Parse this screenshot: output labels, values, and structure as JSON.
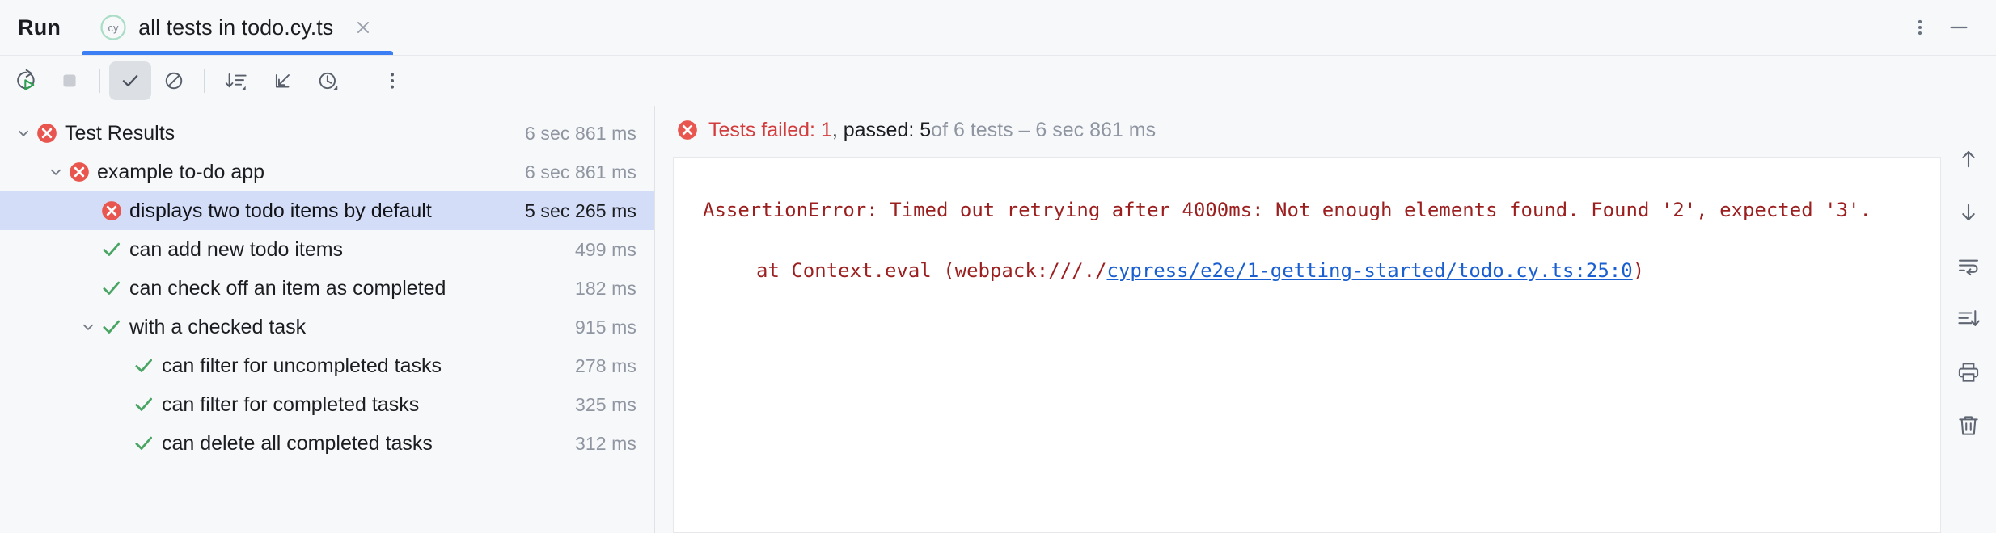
{
  "window": {
    "run_label": "Run",
    "more_options_icon": "more-vertical-icon",
    "minimize_icon": "minimize-icon"
  },
  "tab": {
    "icon": "cypress-icon",
    "title": "all tests in todo.cy.ts",
    "close_icon": "close-icon",
    "accent_color": "#3c7ef3"
  },
  "toolbar": {
    "items": [
      {
        "name": "rerun-tests-button",
        "icon": "rerun-icon",
        "active": false
      },
      {
        "name": "stop-button",
        "icon": "stop-square-icon",
        "active": false
      },
      {
        "name": "show-passed-button",
        "icon": "checkmark-icon",
        "active": true
      },
      {
        "name": "show-ignored-button",
        "icon": "circle-slash-icon",
        "active": false
      },
      {
        "name": "sort-button",
        "icon": "sort-descending-icon",
        "active": false
      },
      {
        "name": "expand-collapse-button",
        "icon": "collapse-arrow-icon",
        "active": false
      },
      {
        "name": "history-button",
        "icon": "clock-history-icon",
        "active": false
      },
      {
        "name": "more-options-button",
        "icon": "more-vertical-icon",
        "active": false
      }
    ]
  },
  "tree": {
    "rows": [
      {
        "label": "Test Results",
        "duration": "6 sec 861 ms",
        "status": "failed",
        "indent": 0,
        "expandable": true,
        "selected": false
      },
      {
        "label": "example to-do app",
        "duration": "6 sec 861 ms",
        "status": "failed",
        "indent": 1,
        "expandable": true,
        "selected": false
      },
      {
        "label": "displays two todo items by default",
        "duration": "5 sec 265 ms",
        "status": "failed",
        "indent": 2,
        "expandable": false,
        "selected": true
      },
      {
        "label": "can add new todo items",
        "duration": "499 ms",
        "status": "passed",
        "indent": 2,
        "expandable": false,
        "selected": false
      },
      {
        "label": "can check off an item as completed",
        "duration": "182 ms",
        "status": "passed",
        "indent": 2,
        "expandable": false,
        "selected": false
      },
      {
        "label": "with a checked task",
        "duration": "915 ms",
        "status": "passed",
        "indent": 1,
        "expandable": true,
        "selected": false
      },
      {
        "label": "can filter for uncompleted tasks",
        "duration": "278 ms",
        "status": "passed",
        "indent": 2,
        "expandable": false,
        "selected": false
      },
      {
        "label": "can filter for completed tasks",
        "duration": "325 ms",
        "status": "passed",
        "indent": 2,
        "expandable": false,
        "selected": false
      },
      {
        "label": "can delete all completed tasks",
        "duration": "312 ms",
        "status": "passed",
        "indent": 2,
        "expandable": false,
        "selected": false
      }
    ]
  },
  "summary": {
    "status_icon": "failed-icon",
    "failed_text": "Tests failed: 1",
    "passed_text": ", passed: 5",
    "muted_text": " of 6 tests – 6 sec 861 ms"
  },
  "console": {
    "error_message": "AssertionError: Timed out retrying after 4000ms: Not enough elements found. Found '2', expected '3'.",
    "stack_prefix": "at Context.eval (webpack:///./",
    "stack_link": "cypress/e2e/1-getting-started/todo.cy.ts:25:0",
    "stack_suffix": ")"
  },
  "console_rail": {
    "items": [
      {
        "name": "scroll-up-button",
        "icon": "arrow-up-icon"
      },
      {
        "name": "scroll-down-button",
        "icon": "arrow-down-icon"
      },
      {
        "name": "soft-wrap-button",
        "icon": "soft-wrap-icon"
      },
      {
        "name": "scroll-to-end-button",
        "icon": "scroll-to-end-icon"
      },
      {
        "name": "print-button",
        "icon": "print-icon"
      },
      {
        "name": "clear-all-button",
        "icon": "trash-icon"
      }
    ]
  },
  "colors": {
    "accent": "#3c7ef3",
    "failed": "#e8564f",
    "passed": "#4aa564",
    "error_text": "#9c1f1f",
    "link": "#1a5fd0",
    "selection": "#d4ddf7"
  }
}
